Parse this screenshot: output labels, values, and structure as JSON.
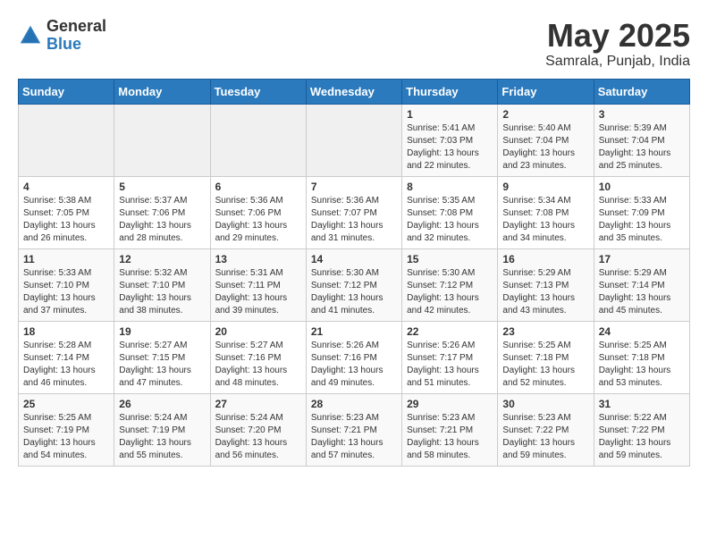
{
  "header": {
    "logo_general": "General",
    "logo_blue": "Blue",
    "month_title": "May 2025",
    "location": "Samrala, Punjab, India"
  },
  "days_of_week": [
    "Sunday",
    "Monday",
    "Tuesday",
    "Wednesday",
    "Thursday",
    "Friday",
    "Saturday"
  ],
  "weeks": [
    [
      {
        "day": "",
        "info": ""
      },
      {
        "day": "",
        "info": ""
      },
      {
        "day": "",
        "info": ""
      },
      {
        "day": "",
        "info": ""
      },
      {
        "day": "1",
        "info": "Sunrise: 5:41 AM\nSunset: 7:03 PM\nDaylight: 13 hours and 22 minutes."
      },
      {
        "day": "2",
        "info": "Sunrise: 5:40 AM\nSunset: 7:04 PM\nDaylight: 13 hours and 23 minutes."
      },
      {
        "day": "3",
        "info": "Sunrise: 5:39 AM\nSunset: 7:04 PM\nDaylight: 13 hours and 25 minutes."
      }
    ],
    [
      {
        "day": "4",
        "info": "Sunrise: 5:38 AM\nSunset: 7:05 PM\nDaylight: 13 hours and 26 minutes."
      },
      {
        "day": "5",
        "info": "Sunrise: 5:37 AM\nSunset: 7:06 PM\nDaylight: 13 hours and 28 minutes."
      },
      {
        "day": "6",
        "info": "Sunrise: 5:36 AM\nSunset: 7:06 PM\nDaylight: 13 hours and 29 minutes."
      },
      {
        "day": "7",
        "info": "Sunrise: 5:36 AM\nSunset: 7:07 PM\nDaylight: 13 hours and 31 minutes."
      },
      {
        "day": "8",
        "info": "Sunrise: 5:35 AM\nSunset: 7:08 PM\nDaylight: 13 hours and 32 minutes."
      },
      {
        "day": "9",
        "info": "Sunrise: 5:34 AM\nSunset: 7:08 PM\nDaylight: 13 hours and 34 minutes."
      },
      {
        "day": "10",
        "info": "Sunrise: 5:33 AM\nSunset: 7:09 PM\nDaylight: 13 hours and 35 minutes."
      }
    ],
    [
      {
        "day": "11",
        "info": "Sunrise: 5:33 AM\nSunset: 7:10 PM\nDaylight: 13 hours and 37 minutes."
      },
      {
        "day": "12",
        "info": "Sunrise: 5:32 AM\nSunset: 7:10 PM\nDaylight: 13 hours and 38 minutes."
      },
      {
        "day": "13",
        "info": "Sunrise: 5:31 AM\nSunset: 7:11 PM\nDaylight: 13 hours and 39 minutes."
      },
      {
        "day": "14",
        "info": "Sunrise: 5:30 AM\nSunset: 7:12 PM\nDaylight: 13 hours and 41 minutes."
      },
      {
        "day": "15",
        "info": "Sunrise: 5:30 AM\nSunset: 7:12 PM\nDaylight: 13 hours and 42 minutes."
      },
      {
        "day": "16",
        "info": "Sunrise: 5:29 AM\nSunset: 7:13 PM\nDaylight: 13 hours and 43 minutes."
      },
      {
        "day": "17",
        "info": "Sunrise: 5:29 AM\nSunset: 7:14 PM\nDaylight: 13 hours and 45 minutes."
      }
    ],
    [
      {
        "day": "18",
        "info": "Sunrise: 5:28 AM\nSunset: 7:14 PM\nDaylight: 13 hours and 46 minutes."
      },
      {
        "day": "19",
        "info": "Sunrise: 5:27 AM\nSunset: 7:15 PM\nDaylight: 13 hours and 47 minutes."
      },
      {
        "day": "20",
        "info": "Sunrise: 5:27 AM\nSunset: 7:16 PM\nDaylight: 13 hours and 48 minutes."
      },
      {
        "day": "21",
        "info": "Sunrise: 5:26 AM\nSunset: 7:16 PM\nDaylight: 13 hours and 49 minutes."
      },
      {
        "day": "22",
        "info": "Sunrise: 5:26 AM\nSunset: 7:17 PM\nDaylight: 13 hours and 51 minutes."
      },
      {
        "day": "23",
        "info": "Sunrise: 5:25 AM\nSunset: 7:18 PM\nDaylight: 13 hours and 52 minutes."
      },
      {
        "day": "24",
        "info": "Sunrise: 5:25 AM\nSunset: 7:18 PM\nDaylight: 13 hours and 53 minutes."
      }
    ],
    [
      {
        "day": "25",
        "info": "Sunrise: 5:25 AM\nSunset: 7:19 PM\nDaylight: 13 hours and 54 minutes."
      },
      {
        "day": "26",
        "info": "Sunrise: 5:24 AM\nSunset: 7:19 PM\nDaylight: 13 hours and 55 minutes."
      },
      {
        "day": "27",
        "info": "Sunrise: 5:24 AM\nSunset: 7:20 PM\nDaylight: 13 hours and 56 minutes."
      },
      {
        "day": "28",
        "info": "Sunrise: 5:23 AM\nSunset: 7:21 PM\nDaylight: 13 hours and 57 minutes."
      },
      {
        "day": "29",
        "info": "Sunrise: 5:23 AM\nSunset: 7:21 PM\nDaylight: 13 hours and 58 minutes."
      },
      {
        "day": "30",
        "info": "Sunrise: 5:23 AM\nSunset: 7:22 PM\nDaylight: 13 hours and 59 minutes."
      },
      {
        "day": "31",
        "info": "Sunrise: 5:22 AM\nSunset: 7:22 PM\nDaylight: 13 hours and 59 minutes."
      }
    ]
  ]
}
